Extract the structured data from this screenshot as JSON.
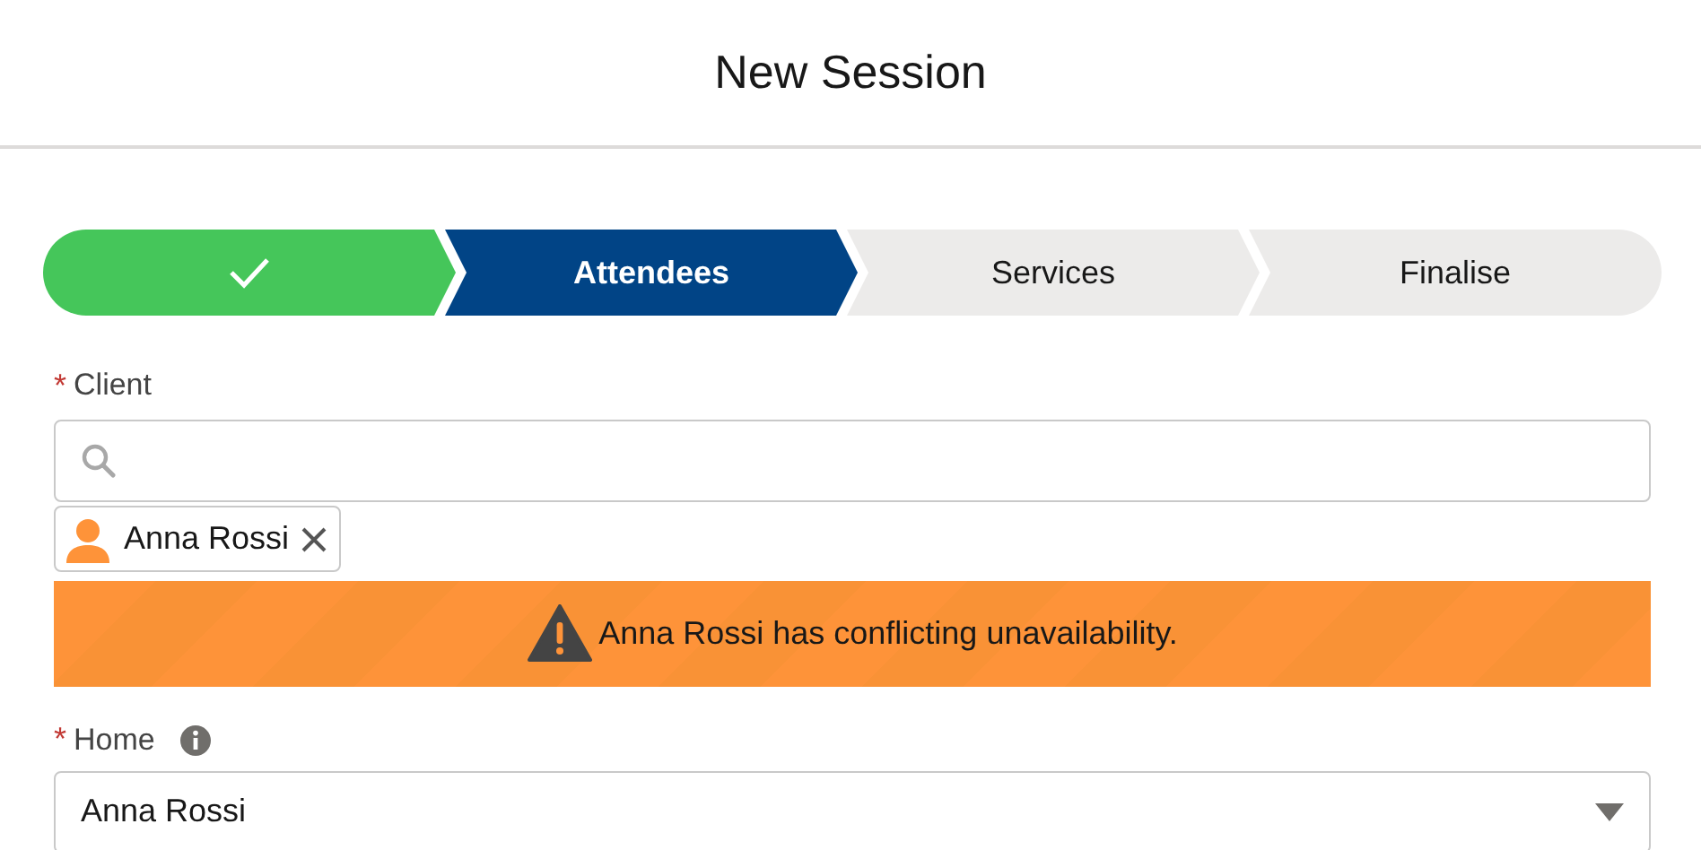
{
  "header": {
    "title": "New Session"
  },
  "path": [
    {
      "kind": "complete"
    },
    {
      "kind": "current",
      "label": "Attendees"
    },
    {
      "kind": "incomplete",
      "label": "Services"
    },
    {
      "kind": "incomplete",
      "label": "Finalise"
    }
  ],
  "client": {
    "label": "Client",
    "required_mark": "*",
    "selected_name": "Anna Rossi"
  },
  "warning": {
    "text": "Anna Rossi has conflicting unavailability."
  },
  "home": {
    "label": "Home",
    "required_mark": "*",
    "value": "Anna Rossi"
  }
}
